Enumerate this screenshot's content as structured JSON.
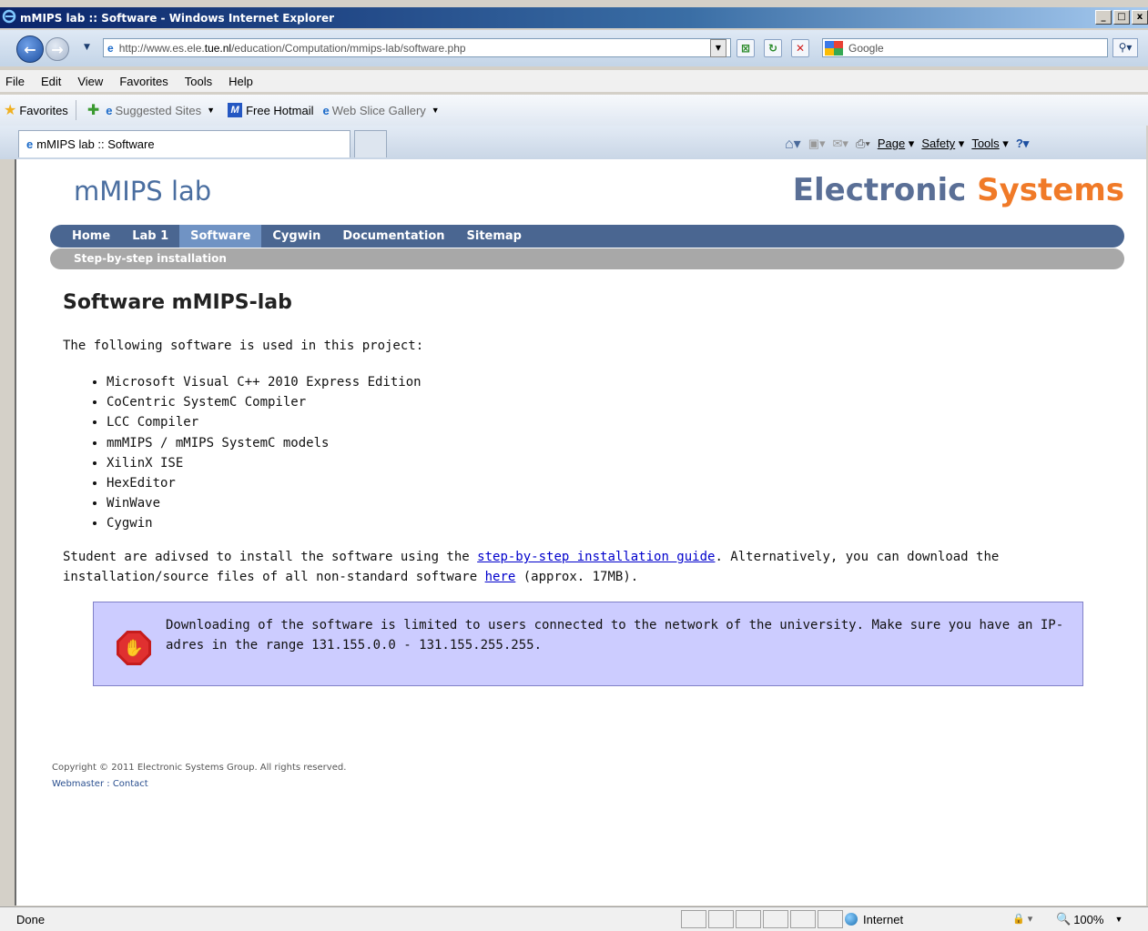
{
  "browser": {
    "window_title": "mMIPS lab :: Software - Windows Internet Explorer",
    "url_prefix": "http://www.es.ele.",
    "url_domain": "tue.nl",
    "url_path": "/education/Computation/mmips-lab/software.php",
    "search_placeholder": "Google",
    "menu": [
      "File",
      "Edit",
      "View",
      "Favorites",
      "Tools",
      "Help"
    ],
    "favorites": {
      "label": "Favorites",
      "suggested_sites": "Suggested Sites",
      "free_hotmail": "Free Hotmail",
      "web_slice_gallery": "Web Slice Gallery"
    },
    "tab_title": "mMIPS lab :: Software",
    "commands": {
      "page": "Page",
      "safety": "Safety",
      "tools": "Tools"
    },
    "status": {
      "text": "Done",
      "zone": "Internet",
      "zoom": "100%"
    }
  },
  "site": {
    "title": "mMIPS lab",
    "brand_part1": "Electronic",
    "brand_part2": "Systems",
    "nav": [
      "Home",
      "Lab 1",
      "Software",
      "Cygwin",
      "Documentation",
      "Sitemap"
    ],
    "active_nav": "Software",
    "subnav": "Step-by-step installation"
  },
  "content": {
    "heading": "Software mMIPS-lab",
    "intro": "The following software is used in this project:",
    "software": [
      "Microsoft Visual C++ 2010 Express Edition",
      "CoCentric SystemC Compiler",
      "LCC Compiler",
      "mmMIPS / mMIPS SystemC models",
      "XilinX ISE",
      "HexEditor",
      "WinWave",
      "Cygwin"
    ],
    "para_part1": "Student are adivsed to install the software using the ",
    "para_link1": "step-by-step installation guide",
    "para_part2": ". Alternatively, you can download the installation/source files of all non-standard software ",
    "para_link2": "here",
    "para_part3": " (approx. 17MB).",
    "notice": "Downloading of the software is limited to users connected to the network of the university. Make sure you have an IP-adres in the range 131.155.0.0 - 131.155.255.255."
  },
  "footer": {
    "copyright": "Copyright © 2011 Electronic Systems Group. All rights reserved.",
    "webmaster": "Webmaster",
    "separator": " : ",
    "contact": "Contact"
  },
  "colors": {
    "nav_bg": "#4a6691",
    "nav_active": "#7093c4",
    "brand_orange": "#f07a28",
    "notice_bg": "#ccccff"
  }
}
